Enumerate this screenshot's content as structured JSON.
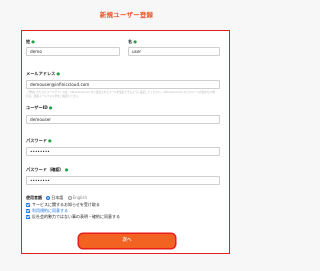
{
  "page": {
    "title": "新規ユーザー登録"
  },
  "form": {
    "last_name": {
      "label": "姓",
      "value": "demo"
    },
    "first_name": {
      "label": "名",
      "value": "user"
    },
    "email": {
      "label": "メールアドレス",
      "value": "demouser@infiniccloud.com"
    },
    "note": "ご登録いただいたメールアドレスは、infinicloud.com から送信されるメールを受信できるように設定してください。infinicloud.com からのメールが届かない場合は、迷惑メールフォルダをご確認ください。",
    "user_id": {
      "label": "ユーザーID",
      "value": "demouser"
    },
    "password": {
      "label": "パスワード",
      "value": "••••••••"
    },
    "password_confirm": {
      "label": "パスワード（確認）",
      "value": "••••••••"
    },
    "required_mark": "●",
    "language": {
      "label": "使用言語",
      "options": [
        {
          "label": "日本語",
          "selected": true
        },
        {
          "label": "English",
          "selected": false
        }
      ]
    },
    "checkboxes": [
      {
        "label": "サービスに関するお知らせを受け取る",
        "checked": true,
        "link": false
      },
      {
        "label": "利用規約に同意する",
        "checked": true,
        "link": true
      },
      {
        "label": "反社会的勢力ではない事の表明・確約に同意する",
        "checked": true,
        "link": false
      }
    ]
  },
  "submit": {
    "label": "次へ"
  },
  "colors": {
    "accent": "#f26322",
    "highlight_border": "#e81e1e",
    "required": "#26a34a",
    "link": "#1a73e8"
  }
}
